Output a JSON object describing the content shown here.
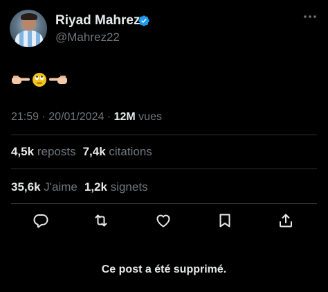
{
  "author": {
    "name": "Riyad Mahrez",
    "handle": "@Mahrez22",
    "verified": true,
    "verified_color": "#1d9bf0"
  },
  "post": {
    "content_emojis": [
      "👉🏻",
      "🙄",
      "👈🏻"
    ],
    "time": "21:59",
    "separator": "·",
    "date": "20/01/2024",
    "views_count": "12M",
    "views_label": "vues"
  },
  "stats": {
    "reposts_count": "4,5k",
    "reposts_label": "reposts",
    "citations_count": "7,4k",
    "citations_label": "citations",
    "likes_count": "35,6k",
    "likes_label": "J'aime",
    "bookmarks_count": "1,2k",
    "bookmarks_label": "signets"
  },
  "actions": [
    "reply-icon",
    "repost-icon",
    "like-icon",
    "bookmark-icon",
    "share-icon"
  ],
  "notice": "Ce post a été supprimé.",
  "colors": {
    "background": "#000000",
    "text": "#e7e9ea",
    "muted": "#71767b",
    "divider": "#2f3336"
  }
}
